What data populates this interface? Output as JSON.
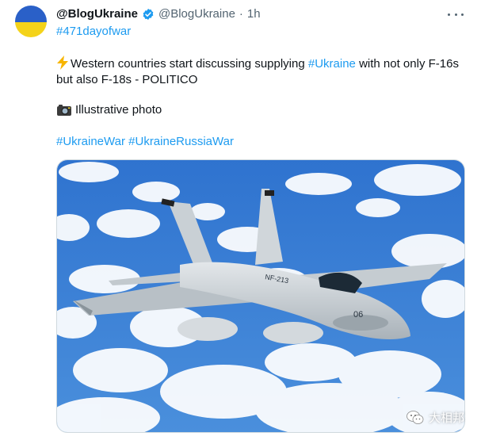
{
  "tweet": {
    "display_name": "@BlogUkraine",
    "handle": "@BlogUkraine",
    "dot": "·",
    "time": "1h",
    "hashtag_top": "#471dayofwar",
    "body_part1": "Western countries start discussing supplying ",
    "body_tag": "#Ukraine",
    "body_part2": " with not only F-16s but also F-18s - POLITICO",
    "photo_caption": "Illustrative photo",
    "tags": [
      "#UkraineWar",
      "#UkraineRussiaWar"
    ]
  },
  "image": {
    "tail_code": "NF-213",
    "nose_number": "06"
  },
  "watermark": {
    "label": "大相邦"
  },
  "icons": {
    "verified": "verified-badge-icon",
    "lightning": "high-voltage-emoji-icon",
    "camera": "camera-flash-emoji-icon",
    "more": "more-options-icon",
    "wechat": "wechat-logo-icon"
  },
  "colors": {
    "link": "#1d9bf0",
    "secondary_text": "#536471",
    "sky": "#3f82d6",
    "flag_blue": "#2a60c8",
    "flag_yellow": "#f4d31a"
  }
}
